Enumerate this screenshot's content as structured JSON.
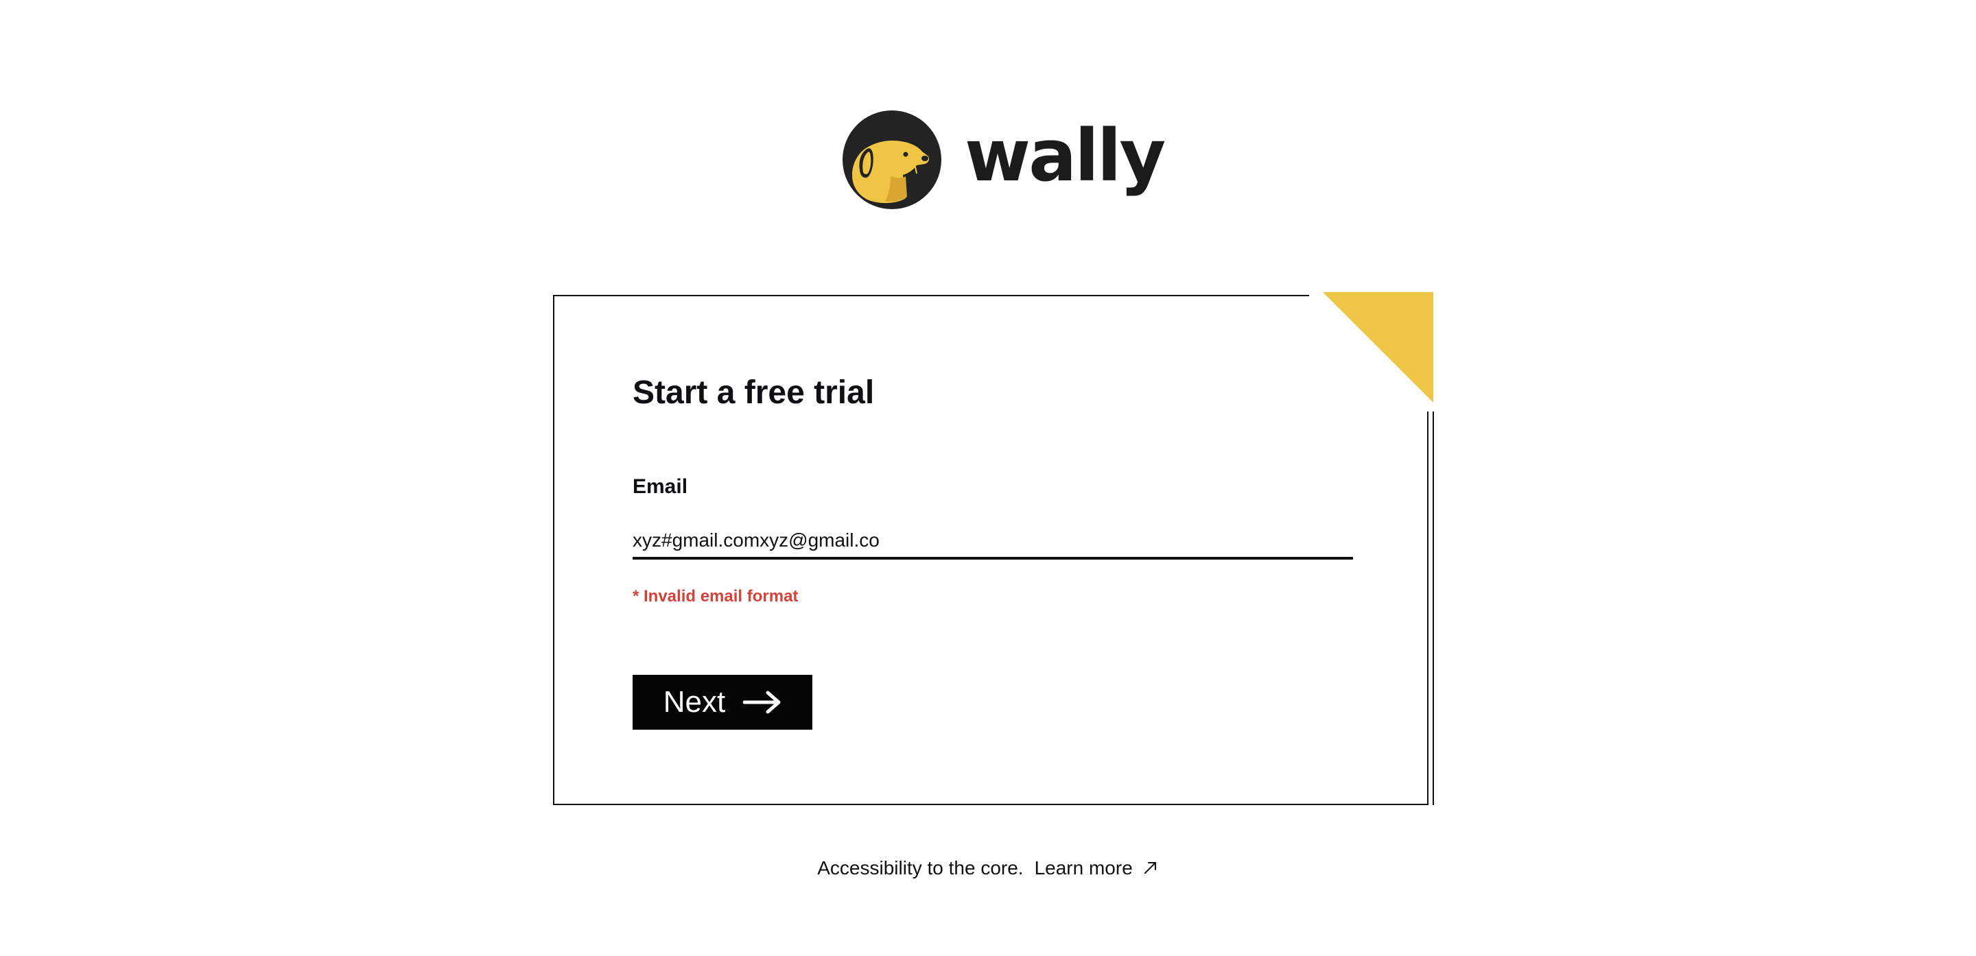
{
  "brand": {
    "name": "wally",
    "logo_icon": "dog-head-icon",
    "colors": {
      "accent": "#F0C445",
      "dark": "#222222",
      "error": "#D4433A",
      "button_bg": "#050505"
    }
  },
  "form": {
    "title": "Start a free trial",
    "email_label": "Email",
    "email_value": "xyz#gmail.comxyz@gmail.co",
    "error_message": "* Invalid email format",
    "next_label": "Next",
    "next_icon": "arrow-right-icon"
  },
  "footer": {
    "text": "Accessibility to the core.",
    "link_label": "Learn more",
    "link_icon": "external-link-arrow-icon"
  }
}
